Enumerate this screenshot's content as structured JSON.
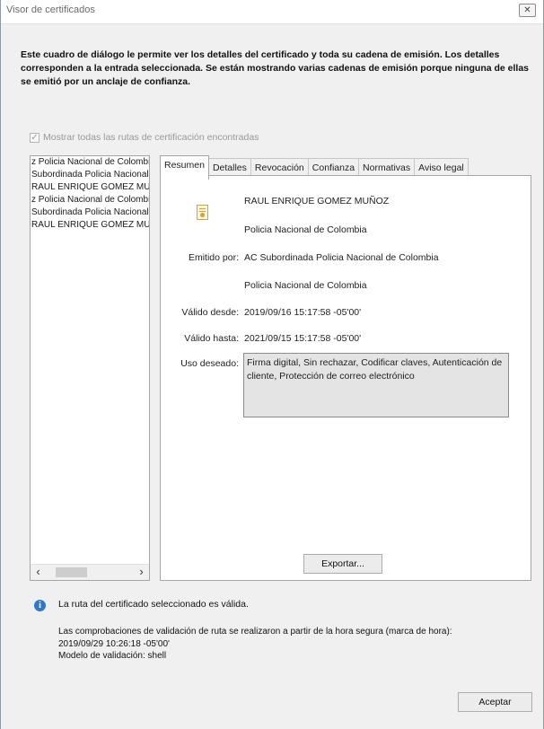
{
  "window": {
    "title": "Visor de certificados",
    "close_label": "✕"
  },
  "description": "Este cuadro de diálogo le permite ver los detalles del certificado y toda su cadena de emisión. Los detalles corresponden a la entrada seleccionada. Se están mostrando varias cadenas de emisión porque ninguna de ellas se emitió por un anclaje de confianza.",
  "show_all_paths": {
    "label": "Mostrar todas las rutas de certificación encontradas",
    "checked": true,
    "enabled": false
  },
  "tree": {
    "items": [
      "z Policia Nacional de Colombia",
      "Subordinada Policia Nacional",
      "RAUL ENRIQUE GOMEZ MUÑOZ",
      "z Policia Nacional de Colombia",
      "Subordinada Policia Nacional",
      "RAUL ENRIQUE GOMEZ MUÑOZ"
    ],
    "scroll_left": "‹",
    "scroll_right": "›"
  },
  "tabs": [
    {
      "label": "Resumen",
      "active": true
    },
    {
      "label": "Detalles",
      "active": false
    },
    {
      "label": "Revocación",
      "active": false
    },
    {
      "label": "Confianza",
      "active": false
    },
    {
      "label": "Normativas",
      "active": false
    },
    {
      "label": "Aviso legal",
      "active": false
    }
  ],
  "summary": {
    "icon": "certificate-icon",
    "subject_name": "RAUL ENRIQUE GOMEZ MUÑOZ",
    "subject_org": "Policia Nacional de Colombia",
    "issued_by_label": "Emitido por:",
    "issuer_name": "AC Subordinada Policia Nacional de Colombia",
    "issuer_org": "Policia Nacional de Colombia",
    "valid_from_label": "Válido desde:",
    "valid_from": "2019/09/16 15:17:58 -05'00'",
    "valid_to_label": "Válido hasta:",
    "valid_to": "2021/09/15 15:17:58 -05'00'",
    "usage_label": "Uso deseado:",
    "usage": "Firma digital, Sin rechazar, Codificar claves, Autenticación de cliente, Protección de correo electrónico",
    "export_label": "Exportar..."
  },
  "status": {
    "icon": "info-icon",
    "message": "La ruta del certificado seleccionado es válida.",
    "validation_line1": "Las comprobaciones de validación de ruta se realizaron a partir de la hora segura (marca de hora):",
    "validation_line2": "2019/09/29 10:26:18 -05'00'",
    "validation_line3": "Modelo de validación: shell"
  },
  "accept_label": "Aceptar",
  "colors": {
    "info": "#2f78c8",
    "dialog_bg": "#f0f0f0"
  }
}
